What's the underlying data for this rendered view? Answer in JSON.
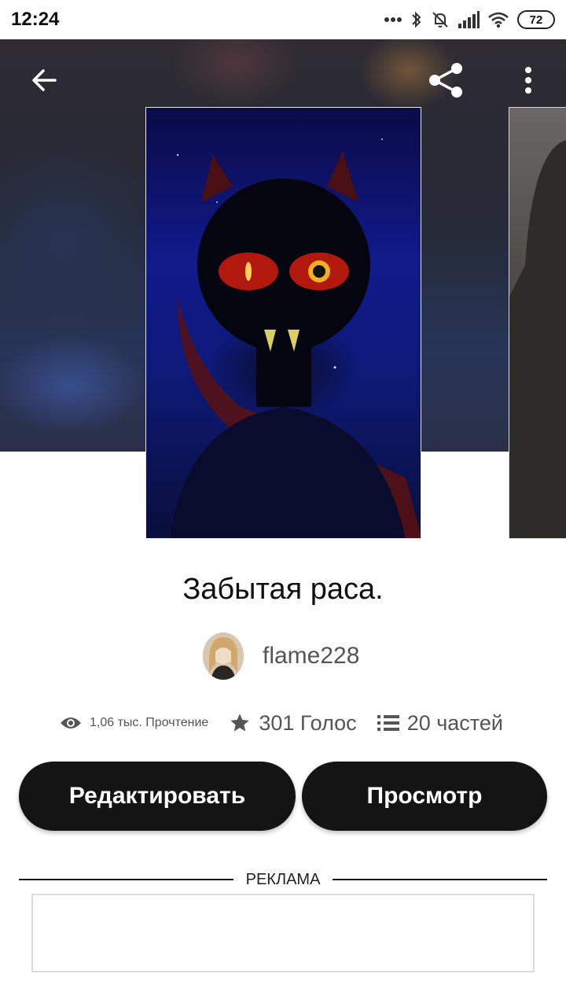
{
  "status_bar": {
    "time": "12:24",
    "battery": "72",
    "icons": [
      "more-dots-icon",
      "bluetooth-icon",
      "bell-off-icon",
      "signal-icon",
      "wifi-icon",
      "battery-icon"
    ]
  },
  "header": {
    "back_icon": "arrow-left-icon",
    "share_icon": "share-icon",
    "menu_icon": "more-vertical-icon"
  },
  "story": {
    "title": "Забытая раса.",
    "author": "flame228",
    "stats": {
      "views": "1,06 тыс. Прочтение",
      "votes": "301 Голос",
      "parts": "20 частей"
    }
  },
  "actions": {
    "edit_label": "Редактировать",
    "view_label": "Просмотр"
  },
  "ad": {
    "label": "РЕКЛАМА"
  }
}
